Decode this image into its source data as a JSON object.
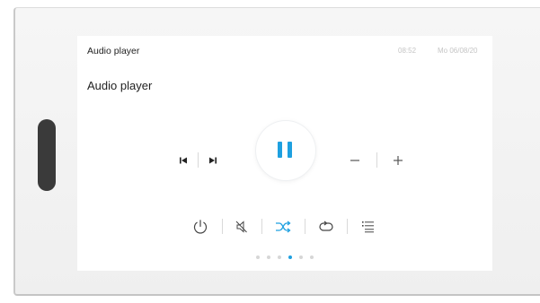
{
  "header": {
    "title": "Audio player",
    "time": "08:52",
    "date": "Mo 06/08/20"
  },
  "page": {
    "title": "Audio player"
  },
  "transport": {
    "previous": "skip-previous-icon",
    "next": "skip-next-icon",
    "play_pause": "pause-icon",
    "volume_down": "minus-icon",
    "volume_up": "plus-icon"
  },
  "bottom_controls": [
    "power-icon",
    "mute-icon",
    "shuffle-icon",
    "repeat-icon",
    "playlist-icon"
  ],
  "shuffle_active": true,
  "pagination": {
    "count": 6,
    "active_index": 3
  },
  "colors": {
    "accent": "#1ea0e0",
    "text": "#222222",
    "muted": "#c5c5c5",
    "background": "#ffffff"
  }
}
